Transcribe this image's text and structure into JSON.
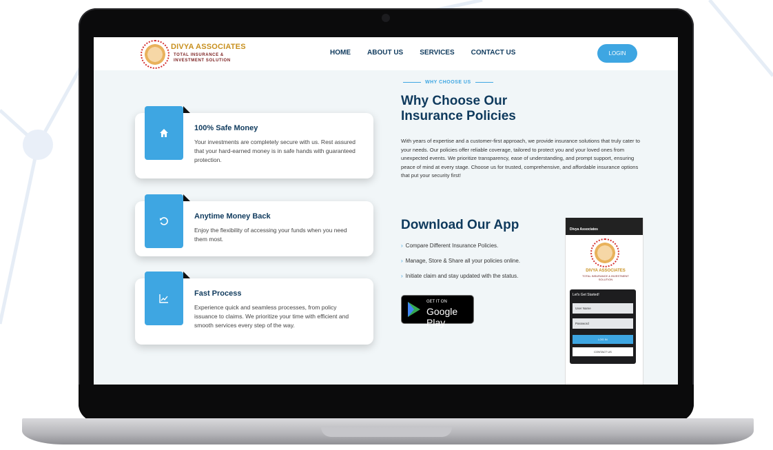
{
  "header": {
    "logo_title": "DIVYA ASSOCIATES",
    "logo_subtitle_line1": "TOTAL INSURANCE &",
    "logo_subtitle_line2": "INVESTMENT SOLUTION",
    "nav": [
      "HOME",
      "ABOUT US",
      "SERVICES",
      "CONTACT US"
    ],
    "login_label": "LOGIN"
  },
  "features": [
    {
      "icon": "home-icon",
      "title": "100% Safe Money",
      "text": "Your investments are completely secure with us. Rest assured that your hard-earned money is in safe hands with guaranteed protection."
    },
    {
      "icon": "refresh-icon",
      "title": "Anytime Money Back",
      "text": "Enjoy the flexibility of accessing your funds when you need them most."
    },
    {
      "icon": "chart-line-icon",
      "title": "Fast Process",
      "text": "Experience quick and seamless processes, from policy issuance to claims. We prioritize your time with efficient and smooth services every step of the way."
    }
  ],
  "why": {
    "eyebrow": "WHY CHOOSE US",
    "title": "Why Choose Our Insurance Policies",
    "description": "With years of expertise and a customer-first approach, we provide insurance solutions that truly cater to your needs. Our policies offer reliable coverage, tailored to protect you and your loved ones from unexpected events. We prioritize transparency, ease of understanding, and prompt support, ensuring peace of mind at every stage. Choose us for trusted, comprehensive, and affordable insurance options that put your security first!"
  },
  "app": {
    "title": "Download Our App",
    "bullets": [
      "Compare Different Insurance Policies.",
      "Manage, Store & Share all your policies online.",
      "Initiate claim and stay updated with the status."
    ],
    "store_badge_small": "GET IT ON",
    "store_badge_large": "Google Play"
  },
  "phone": {
    "app_bar": "Divya Associates",
    "title": "DIVYA ASSOCIATES",
    "subtitle": "TOTAL INSURANCE & INVESTMENT SOLUTION",
    "panel_title": "Let's Get Started!",
    "username_placeholder": "User Name",
    "password_placeholder": "Password",
    "login_button": "LOG IN",
    "contact_button": "CONTACT US"
  },
  "colors": {
    "accent": "#3ea6e2",
    "heading": "#0f3a5d",
    "page_bg": "#f1f6f8"
  }
}
